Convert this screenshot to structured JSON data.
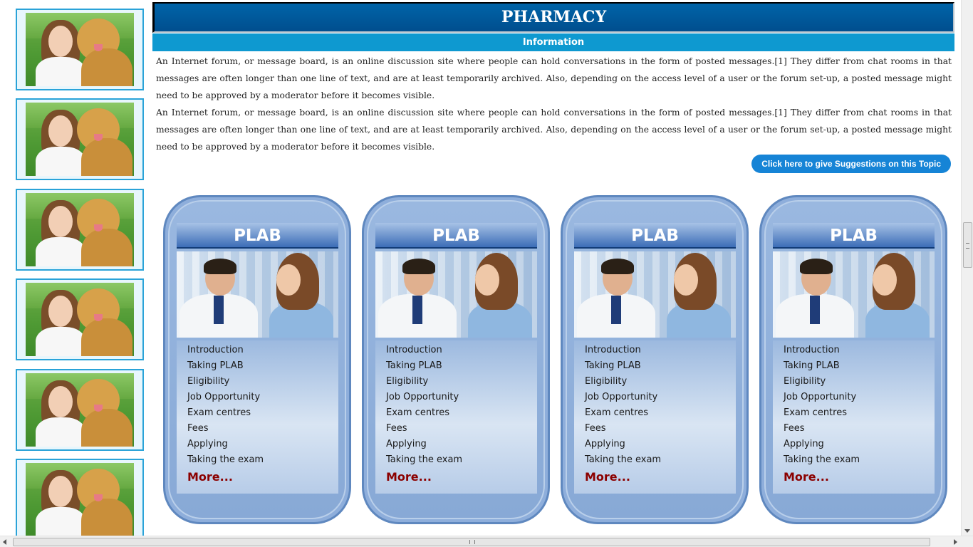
{
  "colors": {
    "banner": "#0064a8",
    "infobar": "#0e99d0",
    "suggest_button": "#1684d6",
    "card": "#8eaedb",
    "more_link": "#8b0000",
    "thumb_border": "#2aa3d8"
  },
  "sidebar": {
    "photos": [
      {
        "icon": "woman-with-dog-photo"
      },
      {
        "icon": "woman-with-dog-photo"
      },
      {
        "icon": "woman-with-dog-photo"
      },
      {
        "icon": "woman-with-dog-photo"
      },
      {
        "icon": "woman-with-dog-photo"
      },
      {
        "icon": "woman-with-dog-photo"
      }
    ]
  },
  "header": {
    "title": "PHARMACY",
    "subtitle": "Information"
  },
  "content": {
    "paragraphs": [
      "An Internet forum, or message board, is an online discussion site where people can hold conversations in the form of posted messages.[1] They differ from chat rooms in that messages are often longer than one line of text, and are at least temporarily archived. Also, depending on the access level of a user or the forum set-up, a posted message might need to be approved by a moderator before it becomes visible.",
      "An Internet forum, or message board, is an online discussion site where people can hold conversations in the form of posted messages.[1] They differ from chat rooms in that messages are often longer than one line of text, and are at least temporarily archived. Also, depending on the access level of a user or the forum set-up, a posted message might need to be approved by a moderator before it becomes visible."
    ],
    "suggest_button": "Click here to give Suggestions on this Topic"
  },
  "cards": [
    {
      "title": "PLAB",
      "image_icon": "doctor-patient-photo",
      "items": [
        "Introduction",
        "Taking PLAB",
        "Eligibility",
        "Job Opportunity",
        "Exam centres",
        "Fees",
        "Applying",
        "Taking the exam"
      ],
      "more": "More..."
    },
    {
      "title": "PLAB",
      "image_icon": "doctor-patient-photo",
      "items": [
        "Introduction",
        "Taking PLAB",
        "Eligibility",
        "Job Opportunity",
        "Exam centres",
        "Fees",
        "Applying",
        "Taking the exam"
      ],
      "more": "More..."
    },
    {
      "title": "PLAB",
      "image_icon": "doctor-patient-photo",
      "items": [
        "Introduction",
        "Taking PLAB",
        "Eligibility",
        "Job Opportunity",
        "Exam centres",
        "Fees",
        "Applying",
        "Taking the exam"
      ],
      "more": "More..."
    },
    {
      "title": "PLAB",
      "image_icon": "doctor-patient-photo",
      "items": [
        "Introduction",
        "Taking PLAB",
        "Eligibility",
        "Job Opportunity",
        "Exam centres",
        "Fees",
        "Applying",
        "Taking the exam"
      ],
      "more": "More..."
    }
  ]
}
